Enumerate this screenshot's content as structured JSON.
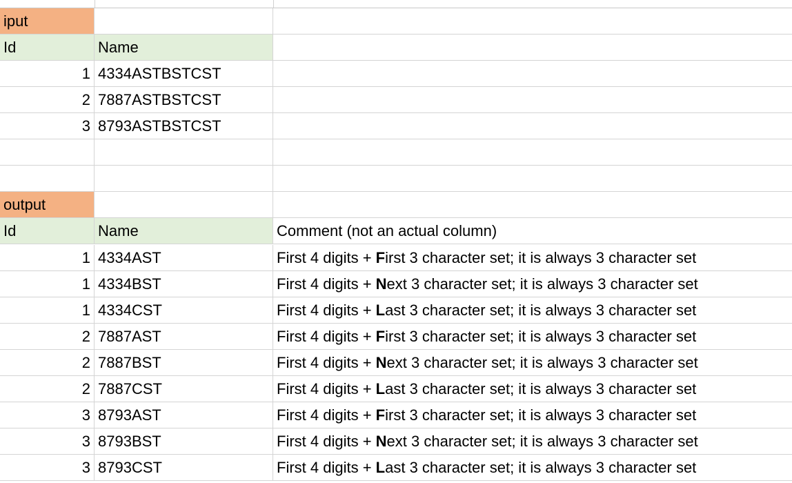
{
  "colors": {
    "section_header": "#f4b183",
    "column_header": "#e2efda",
    "grid": "#d4d4d4"
  },
  "input_section": {
    "label": "iput",
    "headers": {
      "id": "Id",
      "name": "Name"
    },
    "rows": [
      {
        "id": "1",
        "name": "4334ASTBSTCST"
      },
      {
        "id": "2",
        "name": "7887ASTBSTCST"
      },
      {
        "id": "3",
        "name": "8793ASTBSTCST"
      }
    ]
  },
  "output_section": {
    "label": "output",
    "headers": {
      "id": "Id",
      "name": "Name",
      "comment": "Comment (not an actual column)"
    },
    "rows": [
      {
        "id": "1",
        "name": "4334AST",
        "c1": "First 4 digits + ",
        "c_bold": "F",
        "c2": "irst 3 character set; it is always 3 character set"
      },
      {
        "id": "1",
        "name": "4334BST",
        "c1": "First 4 digits + ",
        "c_bold": "N",
        "c2": "ext 3 character set; it is always 3 character set"
      },
      {
        "id": "1",
        "name": "4334CST",
        "c1": "First 4 digits + ",
        "c_bold": "L",
        "c2": "ast 3 character set; it is always 3 character set"
      },
      {
        "id": "2",
        "name": "7887AST",
        "c1": "First 4 digits + ",
        "c_bold": "F",
        "c2": "irst 3 character set; it is always 3 character set"
      },
      {
        "id": "2",
        "name": "7887BST",
        "c1": "First 4 digits + ",
        "c_bold": "N",
        "c2": "ext 3 character set; it is always 3 character set"
      },
      {
        "id": "2",
        "name": "7887CST",
        "c1": "First 4 digits + ",
        "c_bold": "L",
        "c2": "ast 3 character set; it is always 3 character set"
      },
      {
        "id": "3",
        "name": "8793AST",
        "c1": "First 4 digits + ",
        "c_bold": "F",
        "c2": "irst 3 character set; it is always 3 character set"
      },
      {
        "id": "3",
        "name": "8793BST",
        "c1": "First 4 digits + ",
        "c_bold": "N",
        "c2": "ext 3 character set; it is always 3 character set"
      },
      {
        "id": "3",
        "name": "8793CST",
        "c1": "First 4 digits + ",
        "c_bold": "L",
        "c2": "ast 3 character set; it is always 3 character set"
      }
    ]
  }
}
